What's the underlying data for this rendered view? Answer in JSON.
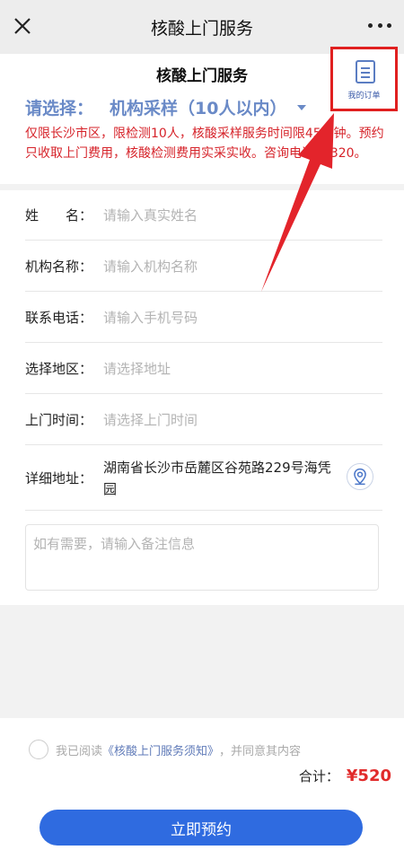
{
  "topbar": {
    "title": "核酸上门服务"
  },
  "header": {
    "title": "核酸上门服务",
    "select_prefix": "请选择：",
    "select_value": "机构采样（10人以内）",
    "notice": "仅限长沙市区，限检测10人，核酸采样服务时间限45分钟。预约只收取上门费用，核酸检测费用实采实收。咨询电话96320。",
    "orders_label": "我的订单"
  },
  "form": {
    "name_label": "姓　　名：",
    "name_placeholder": "请输入真实姓名",
    "org_label": "机构名称：",
    "org_placeholder": "请输入机构名称",
    "phone_label": "联系电话：",
    "phone_placeholder": "请输入手机号码",
    "region_label": "选择地区：",
    "region_placeholder": "请选择地址",
    "time_label": "上门时间：",
    "time_placeholder": "请选择上门时间",
    "address_label": "详细地址：",
    "address_value": "湖南省长沙市岳麓区谷苑路229号海凭园",
    "remark_placeholder": "如有需要，请输入备注信息"
  },
  "footer": {
    "agree_prefix": "我已阅读",
    "agree_link": "《核酸上门服务须知》",
    "agree_suffix": "，并同意其内容",
    "total_label": "合计：",
    "total_amount": "¥520",
    "submit_label": "立即预约"
  },
  "colors": {
    "accent": "#2f6be0",
    "warning": "#d6232a",
    "highlight": "#e02020"
  }
}
